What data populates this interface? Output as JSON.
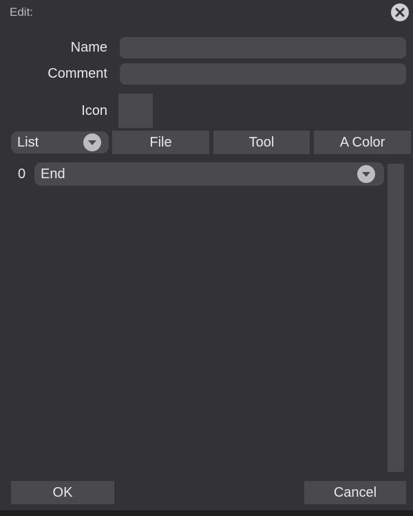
{
  "dialog": {
    "title": "Edit:",
    "close_icon": "close-icon"
  },
  "fields": {
    "name_label": "Name",
    "name_value": "",
    "comment_label": "Comment",
    "comment_value": "",
    "icon_label": "Icon"
  },
  "toolbar": {
    "list_dropdown": {
      "selected": "List",
      "icon": "chevron-down-icon"
    },
    "file_label": "File",
    "tool_label": "Tool",
    "color_label": "A Color"
  },
  "list": {
    "rows": [
      {
        "index": "0",
        "value": "End",
        "icon": "chevron-down-icon"
      }
    ]
  },
  "footer": {
    "ok_label": "OK",
    "cancel_label": "Cancel"
  },
  "colors": {
    "background": "#333337",
    "control": "#4a4a4e",
    "text": "#e8e8e8"
  }
}
